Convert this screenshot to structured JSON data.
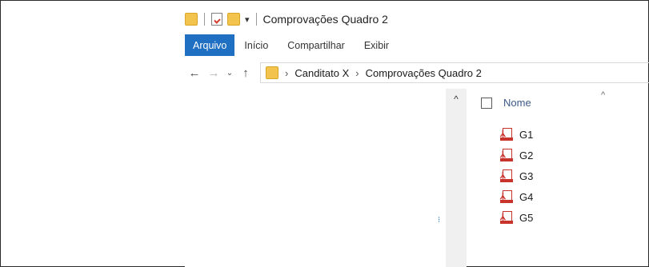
{
  "titlebar": {
    "quick_access_dropdown": "▾",
    "title": "Comprovações Quadro 2"
  },
  "ribbon": {
    "tabs": [
      {
        "label": "Arquivo",
        "active": true
      },
      {
        "label": "Início",
        "active": false
      },
      {
        "label": "Compartilhar",
        "active": false
      },
      {
        "label": "Exibir",
        "active": false
      }
    ]
  },
  "navigation": {
    "back": "←",
    "forward": "→",
    "recent": "⌄",
    "up": "↑"
  },
  "address_bar": {
    "separator": "›",
    "crumbs": [
      "Canditato X",
      "Comprovações Quadro 2"
    ]
  },
  "file_list": {
    "column_name": "Nome",
    "sort_indicator": "^",
    "scroll_up": "^",
    "files": [
      "G1",
      "G2",
      "G3",
      "G4",
      "G5"
    ]
  },
  "colors": {
    "accent": "#1f6fc2",
    "pdf_red": "#c8332b",
    "folder_yellow": "#f3c44d"
  }
}
